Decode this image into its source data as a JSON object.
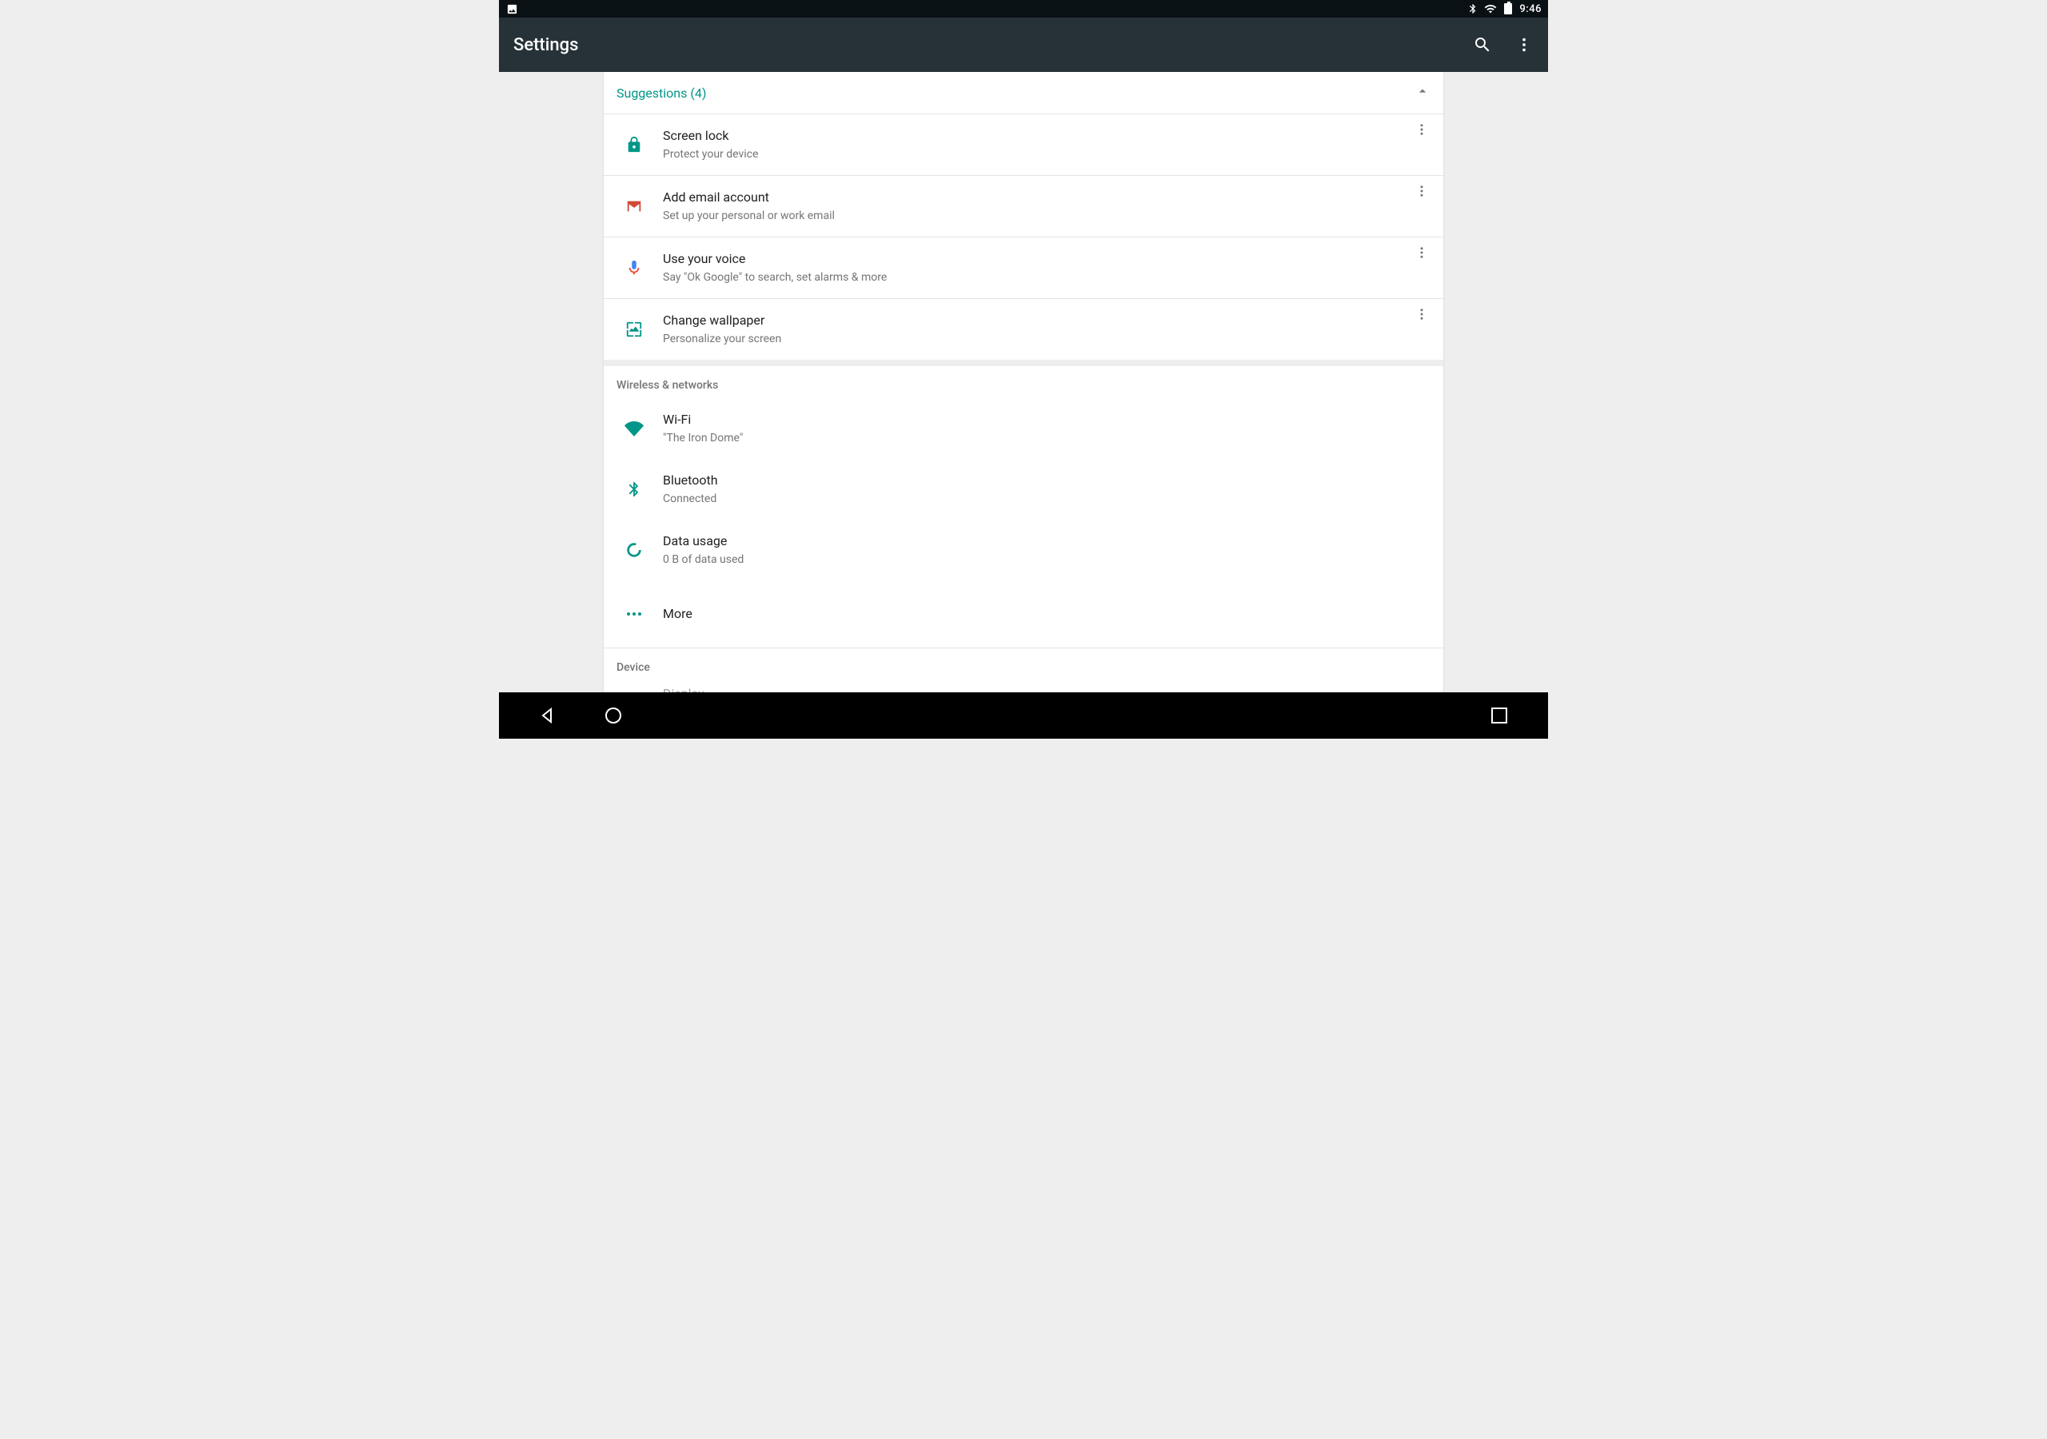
{
  "statusbar": {
    "time": "9:46"
  },
  "appbar": {
    "title": "Settings"
  },
  "suggestions": {
    "header": "Suggestions (4)",
    "items": [
      {
        "title": "Screen lock",
        "subtitle": "Protect your device"
      },
      {
        "title": "Add email account",
        "subtitle": "Set up your personal or work email"
      },
      {
        "title": "Use your voice",
        "subtitle": "Say \"Ok Google\" to search, set alarms & more"
      },
      {
        "title": "Change wallpaper",
        "subtitle": "Personalize your screen"
      }
    ]
  },
  "sections": {
    "wireless": {
      "heading": "Wireless & networks",
      "items": [
        {
          "title": "Wi-Fi",
          "subtitle": "\"The Iron Dome\""
        },
        {
          "title": "Bluetooth",
          "subtitle": "Connected"
        },
        {
          "title": "Data usage",
          "subtitle": "0 B of data used"
        },
        {
          "title": "More"
        }
      ]
    },
    "device": {
      "heading": "Device",
      "items": [
        {
          "title": "Display"
        }
      ]
    }
  }
}
